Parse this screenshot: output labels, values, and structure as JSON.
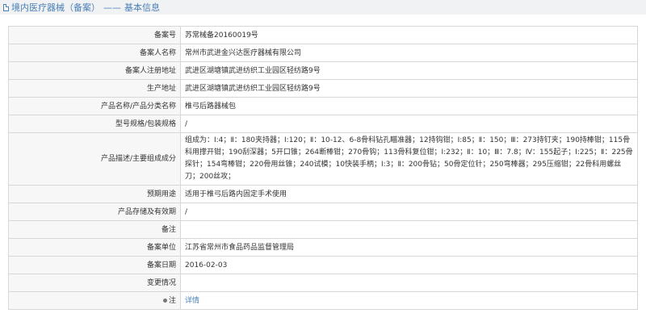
{
  "header": {
    "title_main": "境内医疗器械（备案）",
    "title_sep": "——",
    "title_sub": "基本信息"
  },
  "rows": [
    {
      "label": "备案号",
      "value": "苏常械备20160019号"
    },
    {
      "label": "备案人名称",
      "value": "常州市武进金兴达医疗器械有限公司"
    },
    {
      "label": "备案人注册地址",
      "value": "武进区湖塘镇武进纺织工业园区轻纺路9号"
    },
    {
      "label": "生产地址",
      "value": "武进区湖塘镇武进纺织工业园区轻纺路9号"
    },
    {
      "label": "产品名称/产品分类名称",
      "value": "椎弓后路器械包"
    },
    {
      "label": "型号规格/包装规格",
      "value": "/"
    },
    {
      "label": "产品描述/主要组成成分",
      "value": "组成为：Ⅰ:4；Ⅱ：180夹持器；Ⅰ:120；Ⅱ：10-12、6-8骨科钻孔瞄准器；12持钩钳；Ⅰ:85；Ⅱ：150；Ⅲ：273持钉夹；190持棒钳；115骨科用撑开钳；190刮深器；5开口锥；264断棒钳；270骨钩；113骨科复位钳；Ⅰ:232；Ⅱ：10；Ⅲ：7.8；Ⅳ：155起子；Ⅰ:225；Ⅱ：225骨探针；154弯棒钳；220骨用丝锥；240试模；10快装手柄；Ⅰ:3；Ⅱ：200骨钻；50骨定位针；250弯棒器；295压缩钳；22骨科用螺丝刀；200丝攻；"
    },
    {
      "label": "预期用途",
      "value": "适用于椎弓后路内固定手术使用"
    },
    {
      "label": "产品存储及有效期",
      "value": "/"
    },
    {
      "label": "备注",
      "value": ""
    },
    {
      "label": "备案单位",
      "value": "江苏省常州市食品药品监督管理局"
    },
    {
      "label": "备案日期",
      "value": "2016-02-03"
    },
    {
      "label": "变更情况",
      "value": ""
    },
    {
      "label": "注",
      "value": "详情"
    }
  ],
  "colors": {
    "accent": "#4a7fb6",
    "border": "#d7d7d7",
    "label_bg": "#f7f7f7",
    "header_bg": "#f0f2f4"
  },
  "icons": {
    "header": "document-icon",
    "note": "pin-icon"
  }
}
